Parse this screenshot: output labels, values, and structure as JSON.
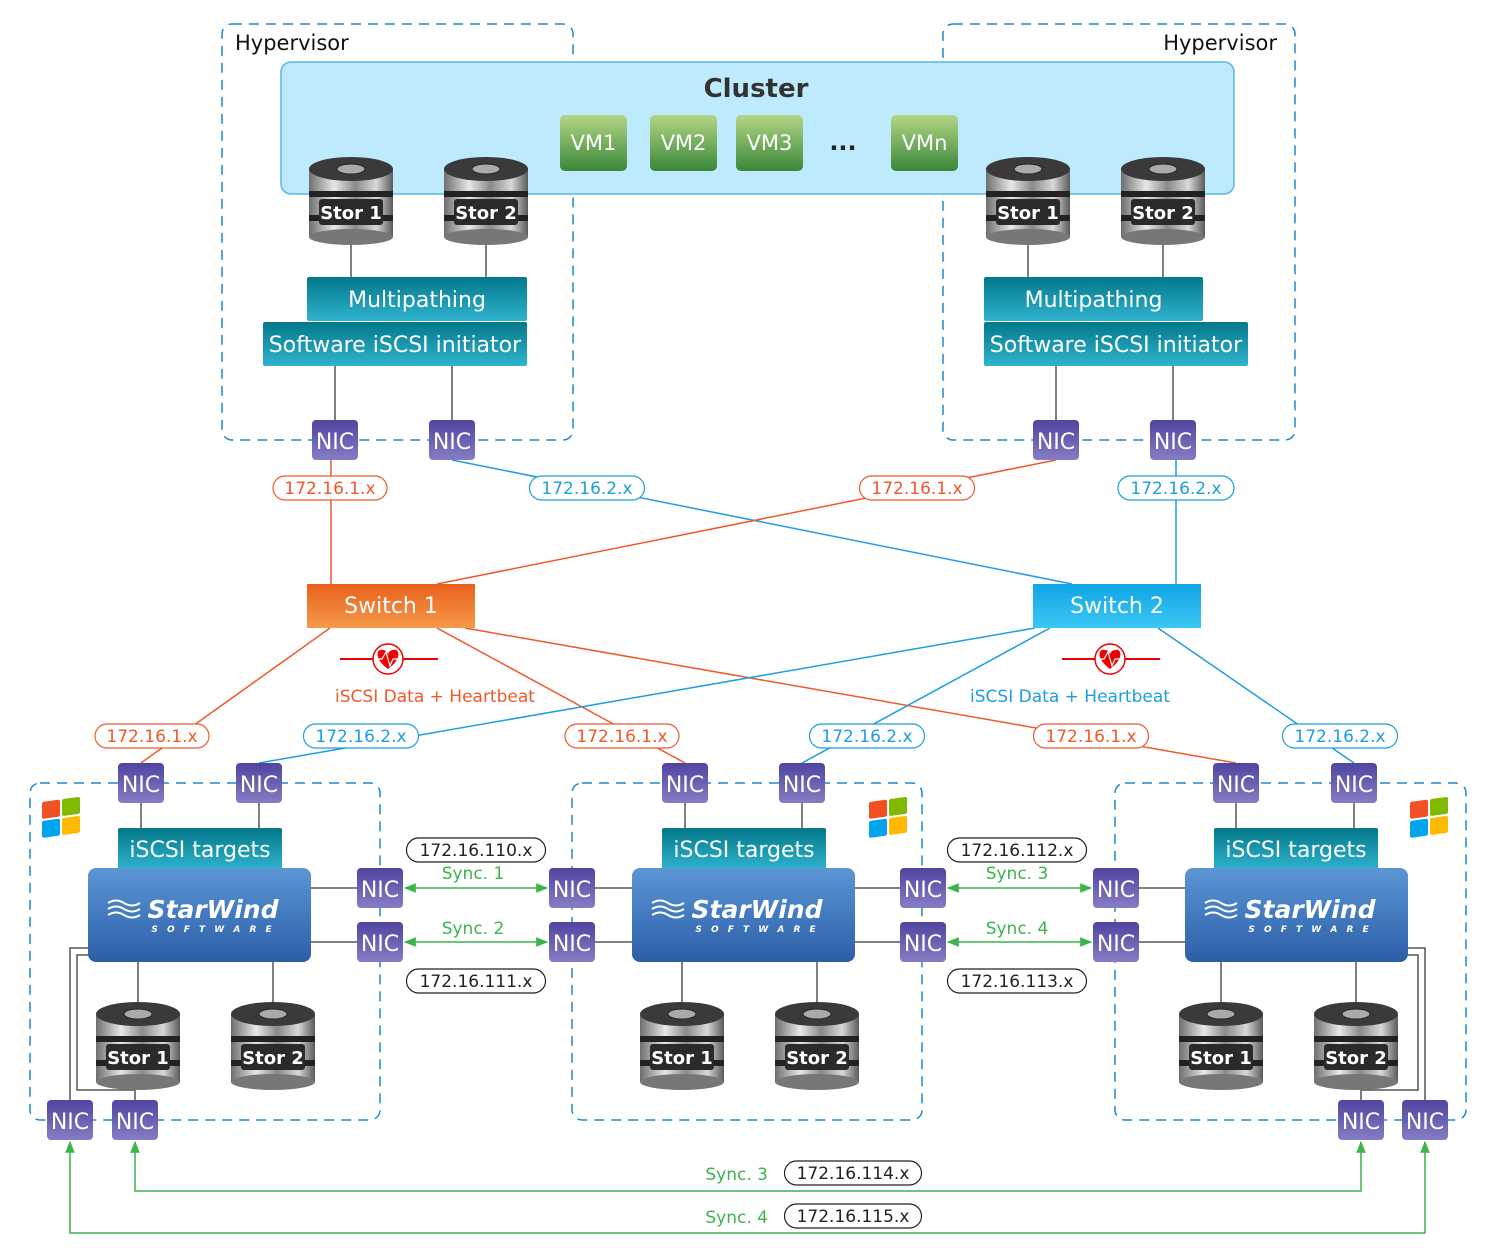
{
  "hypervisors": [
    {
      "label": "Hypervisor"
    },
    {
      "label": "Hypervisor"
    }
  ],
  "cluster": {
    "title": "Cluster",
    "vms": [
      "VM1",
      "VM2",
      "VM3",
      "VMn"
    ],
    "ellipsis": "..."
  },
  "storage": {
    "stor1": "Stor 1",
    "stor2": "Stor 2"
  },
  "stack": {
    "multipathing": "Multipathing",
    "initiator": "Software iSCSI initiator",
    "targets": "iSCSI targets"
  },
  "nic_label": "NIC",
  "switches": [
    {
      "label": "Switch 1",
      "color": "#f07a2a"
    },
    {
      "label": "Switch 2",
      "color": "#1eb2ee"
    }
  ],
  "subnets": {
    "net1": "172.16.1.x",
    "net2": "172.16.2.x"
  },
  "heartbeat": [
    {
      "label": "iSCSI Data + Heartbeat",
      "color": "#f0582a"
    },
    {
      "label": "iSCSI Data + Heartbeat",
      "color": "#1e9ee0"
    }
  ],
  "starwind": {
    "brand": "StarWind",
    "sub": "S O F T W A R E"
  },
  "sync_links": [
    {
      "label": "Sync. 1",
      "subnet": "172.16.110.x"
    },
    {
      "label": "Sync. 2",
      "subnet": "172.16.111.x"
    },
    {
      "label": "Sync. 3",
      "subnet": "172.16.112.x"
    },
    {
      "label": "Sync. 4",
      "subnet": "172.16.113.x"
    },
    {
      "label": "Sync. 3",
      "subnet": "172.16.114.x"
    },
    {
      "label": "Sync. 4",
      "subnet": "172.16.115.x"
    }
  ],
  "colors": {
    "orange": "#f0582a",
    "blue": "#1e9ee0",
    "green": "#3cb44a",
    "nic": "#5b50a8",
    "teal": "#0e94a8",
    "cluster_fill": "#bdeafc"
  }
}
